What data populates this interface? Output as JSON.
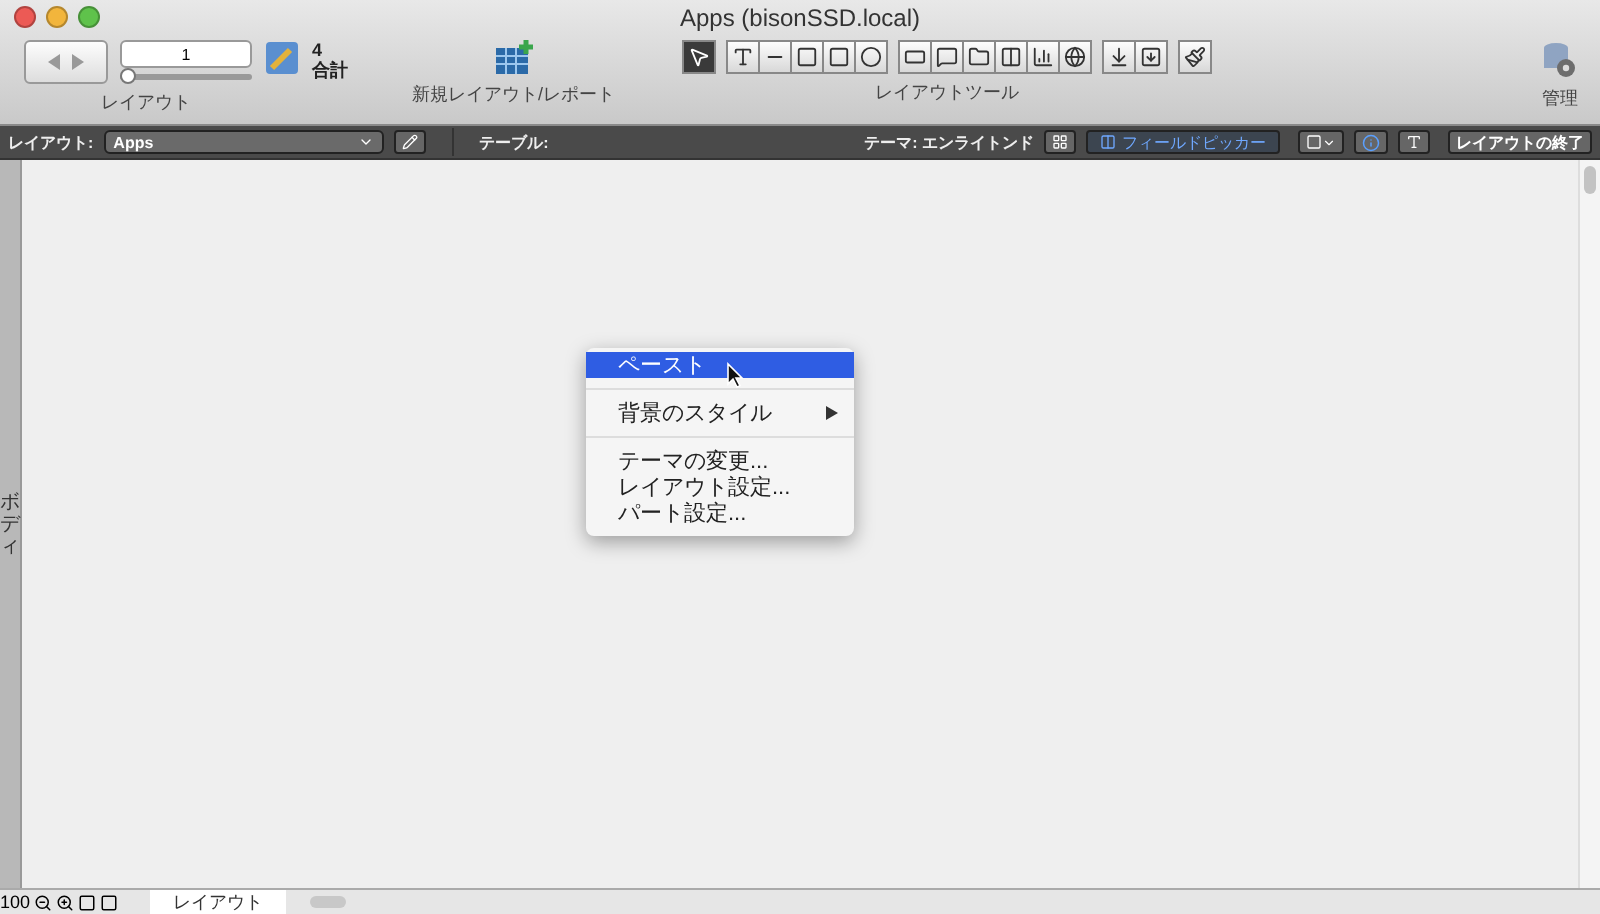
{
  "window": {
    "title": "Apps (bisonSSD.local)"
  },
  "toolbar": {
    "record_field": {
      "value": "1"
    },
    "record_slider": {
      "level": 0
    },
    "record_count": "4",
    "record_count_label": "合計",
    "nav_label": "レイアウト",
    "new_layout_label": "新規レイアウト/レポート",
    "tools_label": "レイアウトツール",
    "manage_label": "管理",
    "tools": [
      {
        "kind": "pointer",
        "selected": true
      },
      {
        "kind": "text",
        "selected": false
      },
      {
        "kind": "line",
        "selected": false
      },
      {
        "kind": "rect",
        "selected": false
      },
      {
        "kind": "rounded",
        "selected": false
      },
      {
        "kind": "oval",
        "selected": false
      },
      {
        "kind": "field",
        "selected": false
      },
      {
        "kind": "button",
        "selected": false
      },
      {
        "kind": "tab",
        "selected": false
      },
      {
        "kind": "portal",
        "selected": false
      },
      {
        "kind": "chart",
        "selected": false
      },
      {
        "kind": "web",
        "selected": false
      },
      {
        "kind": "insert",
        "selected": false
      },
      {
        "kind": "insert2",
        "selected": false
      },
      {
        "kind": "brush",
        "selected": false
      }
    ]
  },
  "layout_bar": {
    "layout_label": "レイアウト:",
    "layout_select": "Apps",
    "table_label": "テーブル:",
    "theme_label": "テーマ: エンライトンド",
    "field_picker": "フィールドピッカー",
    "exit_button": "レイアウトの終了"
  },
  "part_label": "ボディ",
  "context_menu": [
    {
      "kind": "item",
      "label": "ペースト",
      "selected": true,
      "submenu": false
    },
    {
      "kind": "separator"
    },
    {
      "kind": "item",
      "label": "背景のスタイル",
      "selected": false,
      "submenu": true
    },
    {
      "kind": "separator"
    },
    {
      "kind": "item",
      "label": "テーマの変更...",
      "selected": false,
      "submenu": false
    },
    {
      "kind": "item",
      "label": "レイアウト設定...",
      "selected": false,
      "submenu": false
    },
    {
      "kind": "item",
      "label": "パート設定...",
      "selected": false,
      "submenu": false
    }
  ],
  "status_bar": {
    "zoom": "100",
    "mode": "レイアウト"
  }
}
